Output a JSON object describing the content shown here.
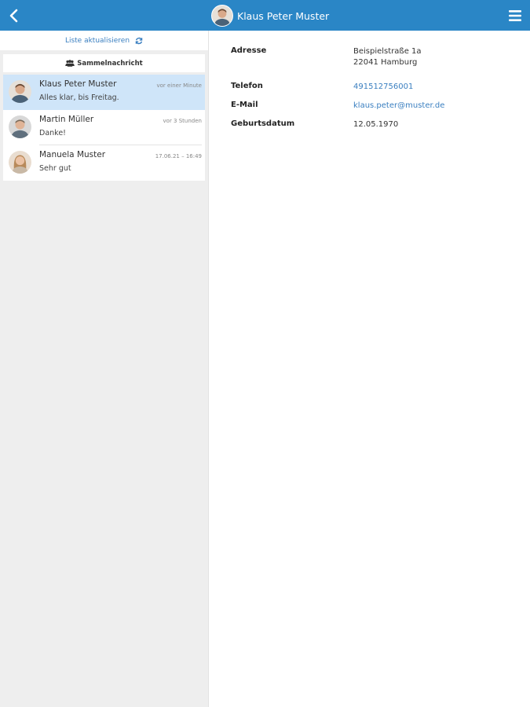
{
  "header": {
    "title": "Klaus Peter Muster",
    "back_icon": "chevron-left-icon",
    "menu_icon": "hamburger-icon"
  },
  "sidebar": {
    "refresh_label": "Liste aktualisieren",
    "broadcast_label": "Sammelnachricht",
    "contacts": [
      {
        "name": "Klaus Peter Muster",
        "time": "vor einer Minute",
        "preview": "Alles klar, bis Freitag.",
        "selected": true
      },
      {
        "name": "Martin Müller",
        "time": "vor 3 Stunden",
        "preview": "Danke!",
        "selected": false
      },
      {
        "name": "Manuela Muster",
        "time": "17.06.21 – 16:49",
        "preview": "Sehr gut",
        "selected": false
      }
    ]
  },
  "detail": {
    "address_label": "Adresse",
    "address_line1": "Beispielstraße 1a",
    "address_line2": "22041 Hamburg",
    "phone_label": "Telefon",
    "phone_value": "491512756001",
    "email_label": "E-Mail",
    "email_value": "klaus.peter@muster.de",
    "birthday_label": "Geburtsdatum",
    "birthday_value": "12.05.1970"
  },
  "colors": {
    "accent": "#2a86c6",
    "link": "#3a7fc0",
    "selected_row": "#cfe5f9",
    "sidebar_bg": "#eeeeee"
  }
}
